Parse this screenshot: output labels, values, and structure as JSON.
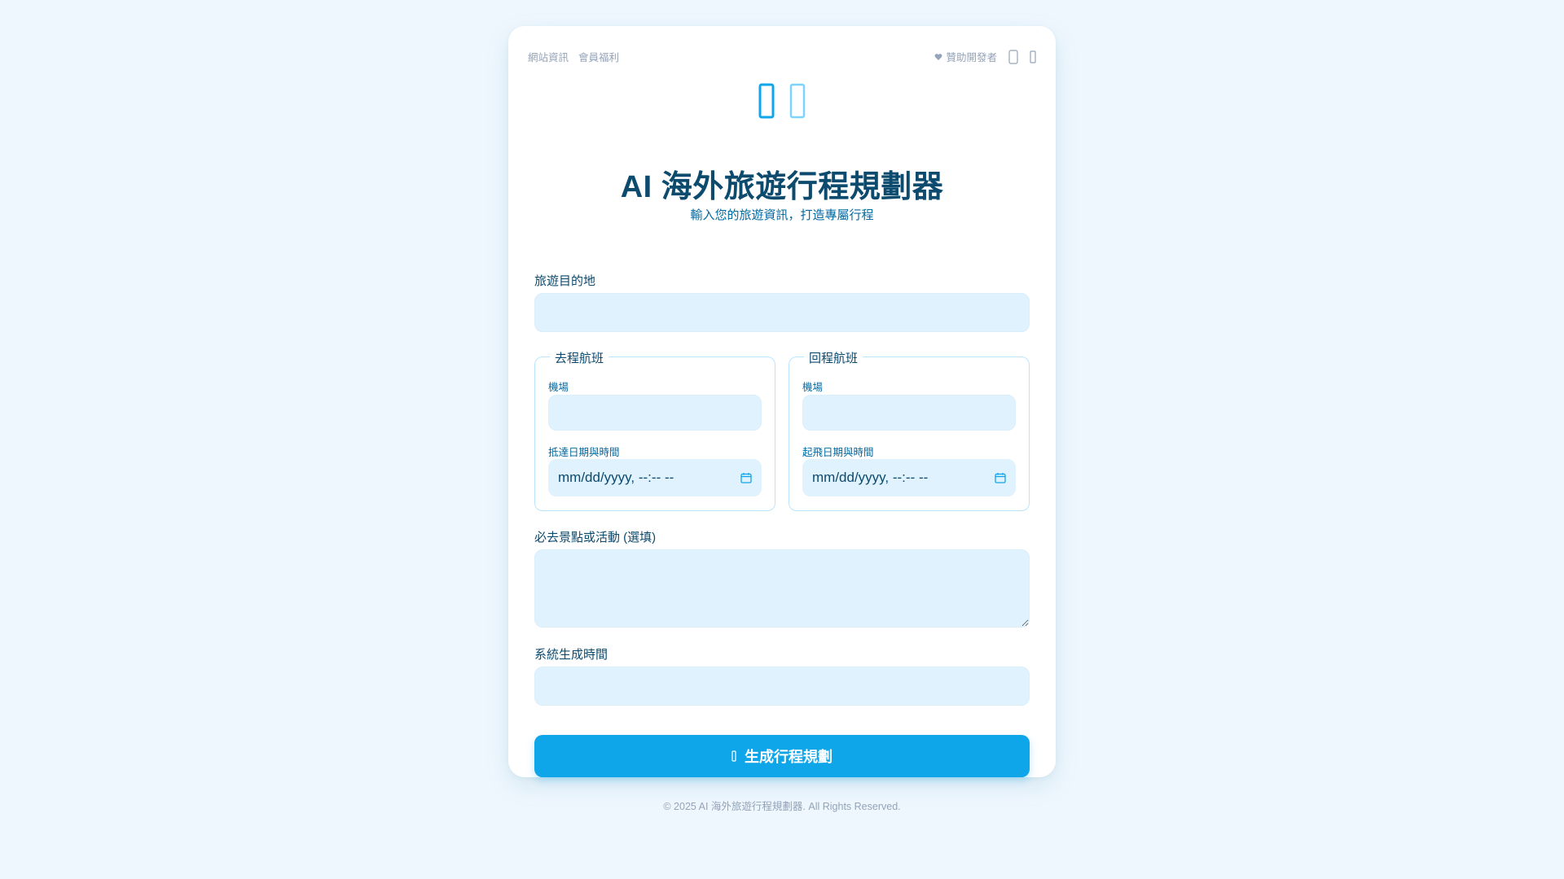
{
  "topnav": {
    "site_info": "網站資訊",
    "member_benefits": "會員福利",
    "sponsor": "贊助開發者",
    "icon_1": "user-icon",
    "icon_2": "menu-icon"
  },
  "header": {
    "logo_icons": [
      "plane-icon",
      "globe-icon"
    ],
    "title": "AI 海外旅遊行程規劃器",
    "subtitle": "輸入您的旅遊資訊，打造專屬行程"
  },
  "form": {
    "destination": {
      "label": "旅遊目的地",
      "value": ""
    },
    "outbound": {
      "legend": "去程航班",
      "airport_label": "機場",
      "airport_value": "",
      "datetime_label": "抵達日期與時間",
      "datetime_placeholder": "mm/dd/yyyy, --:-- --"
    },
    "return": {
      "legend": "回程航班",
      "airport_label": "機場",
      "airport_value": "",
      "datetime_label": "起飛日期與時間",
      "datetime_placeholder": "mm/dd/yyyy, --:-- --"
    },
    "must_visit": {
      "label": "必去景點或活動 (選填)",
      "value": ""
    },
    "generated_time": {
      "label": "系統生成時間",
      "value": ""
    },
    "submit_label": "生成行程規劃"
  },
  "footer": {
    "copyright": "© 2025 AI 海外旅遊行程規劃器. All Rights Reserved."
  },
  "colors": {
    "background": "#eff7fe",
    "accent": "#0ea5e9",
    "title": "#0c4a6e",
    "input_bg": "#e0f2fe"
  }
}
